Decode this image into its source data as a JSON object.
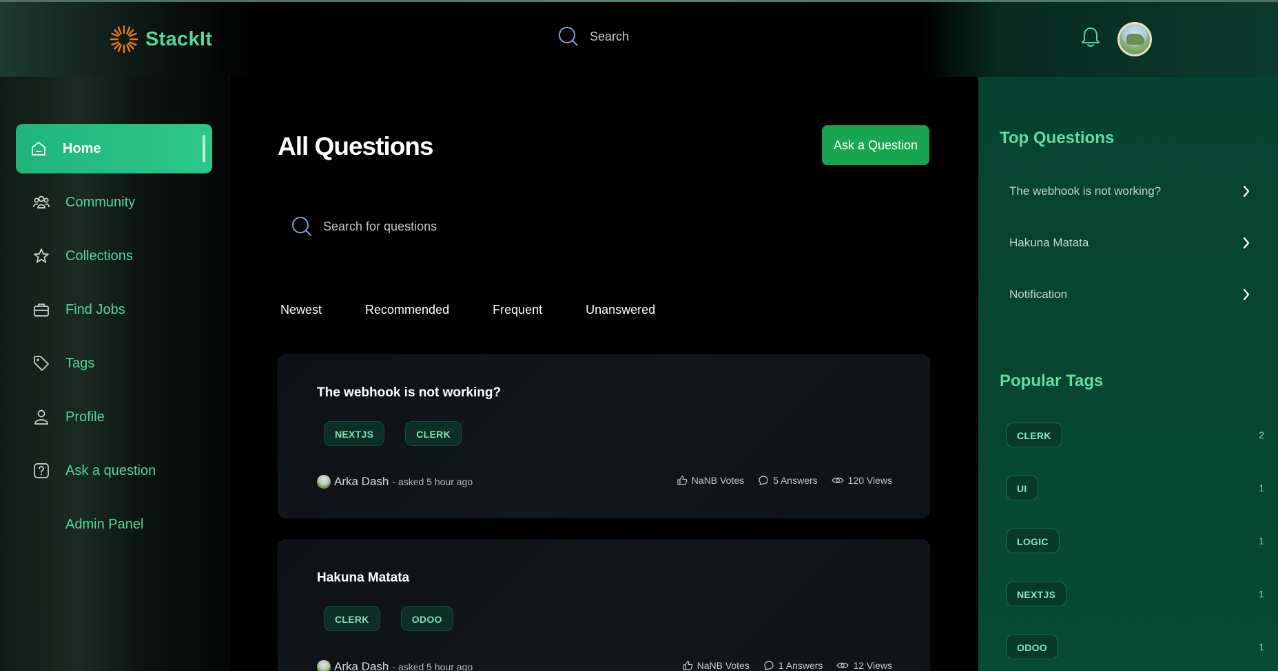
{
  "header": {
    "brand": "StackIt",
    "search_placeholder": "Search"
  },
  "sidebar": {
    "items": [
      {
        "label": "Home",
        "icon": "home-icon",
        "active": true
      },
      {
        "label": "Community",
        "icon": "users-icon"
      },
      {
        "label": "Collections",
        "icon": "star-icon"
      },
      {
        "label": "Find Jobs",
        "icon": "briefcase-icon"
      },
      {
        "label": "Tags",
        "icon": "tag-icon"
      },
      {
        "label": "Profile",
        "icon": "user-icon"
      },
      {
        "label": "Ask a question",
        "icon": "question-icon"
      },
      {
        "label": "Admin Panel",
        "icon": ""
      }
    ]
  },
  "main": {
    "title": "All Questions",
    "ask_button": "Ask a Question",
    "search_placeholder": "Search for questions",
    "filters": [
      "Newest",
      "Recommended",
      "Frequent",
      "Unanswered"
    ],
    "questions": [
      {
        "title": "The webhook is not working?",
        "tags": [
          "NEXTJS",
          "CLERK"
        ],
        "author": "Arka Dash",
        "asked": "- asked 5 hour ago",
        "votes": "NaNB Votes",
        "answers": "5 Answers",
        "views": "120 Views"
      },
      {
        "title": "Hakuna Matata",
        "tags": [
          "CLERK",
          "ODOO"
        ],
        "author": "Arka Dash",
        "asked": "- asked 5 hour ago",
        "votes": "NaNB Votes",
        "answers": "1 Answers",
        "views": "12 Views"
      }
    ]
  },
  "right_panel": {
    "top_questions_heading": "Top Questions",
    "top_questions": [
      "The webhook is not working?",
      "Hakuna Matata",
      "Notification"
    ],
    "popular_tags_heading": "Popular Tags",
    "popular_tags": [
      {
        "name": "CLERK",
        "count": "2"
      },
      {
        "name": "UI",
        "count": "1"
      },
      {
        "name": "LOGIC",
        "count": "1"
      },
      {
        "name": "NEXTJS",
        "count": "1"
      },
      {
        "name": "ODOO",
        "count": "1"
      }
    ]
  },
  "colors": {
    "accent": "#54d69b",
    "active_nav": "#2cc889",
    "ask_button": "#18a550",
    "right_panel": "#064a33"
  }
}
